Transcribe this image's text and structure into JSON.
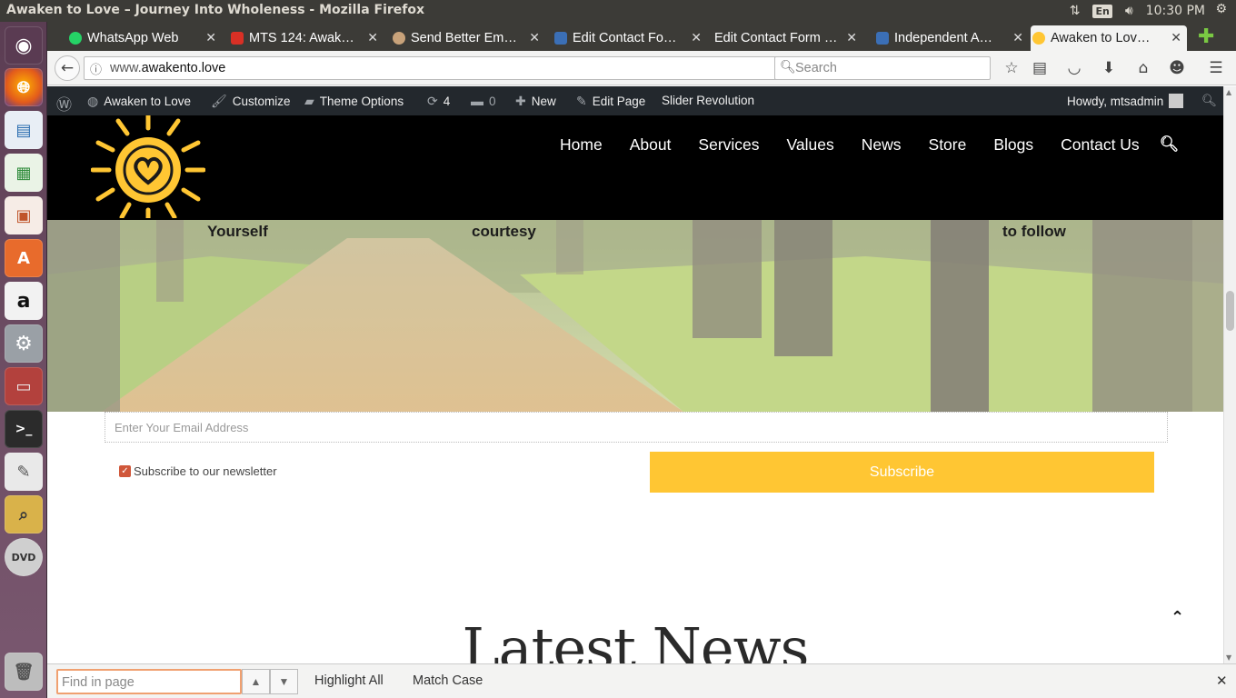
{
  "os": {
    "window_title": "Awaken to Love – Journey Into Wholeness - Mozilla Firefox",
    "kbd_layout": "En",
    "clock": "10:30 PM"
  },
  "launcher": {
    "items": [
      "ubuntu-dash",
      "firefox",
      "libreoffice-draw",
      "libreoffice-calc",
      "libreoffice-impress",
      "ubuntu-software",
      "amazon",
      "system-settings",
      "files",
      "terminal",
      "text-editor",
      "image-viewer",
      "dvd",
      "trash"
    ]
  },
  "tabs": [
    {
      "label": "WhatsApp Web",
      "color": "#25d366"
    },
    {
      "label": "MTS 124: Awak…",
      "color": "#d93025"
    },
    {
      "label": "Send Better Em…",
      "color": "#c8a27a"
    },
    {
      "label": "Edit Contact Fo…",
      "color": "#3b6fb6"
    },
    {
      "label": "Edit Contact Form …",
      "color": "#3c3b37"
    },
    {
      "label": "Independent A…",
      "color": "#3b6fb6"
    },
    {
      "label": "Awaken to Lov…",
      "color": "#ffc633"
    }
  ],
  "nav": {
    "url_prefix": "www.",
    "url_domain": "awakento.love",
    "search_placeholder": "Search"
  },
  "wpbar": {
    "site": "Awaken to Love",
    "customize": "Customize",
    "theme_options": "Theme Options",
    "updates": "4",
    "comments": "0",
    "new": "New",
    "edit_page": "Edit Page",
    "slider": "Slider Revolution",
    "howdy": "Howdy, mtsadmin"
  },
  "site": {
    "menu": [
      "Home",
      "About",
      "Services",
      "Values",
      "News",
      "Store",
      "Blogs",
      "Contact Us"
    ],
    "hero_texts": [
      "Yourself",
      "courtesy",
      "to follow"
    ],
    "email_placeholder": "Enter Your Email Address",
    "newsletter_label": "Subscribe to our newsletter",
    "subscribe_label": "Subscribe",
    "latest_heading": "Latest News",
    "brand_color": "#ffc633"
  },
  "findbar": {
    "placeholder": "Find in page",
    "highlight_all": "Highlight All",
    "match_case": "Match Case"
  }
}
